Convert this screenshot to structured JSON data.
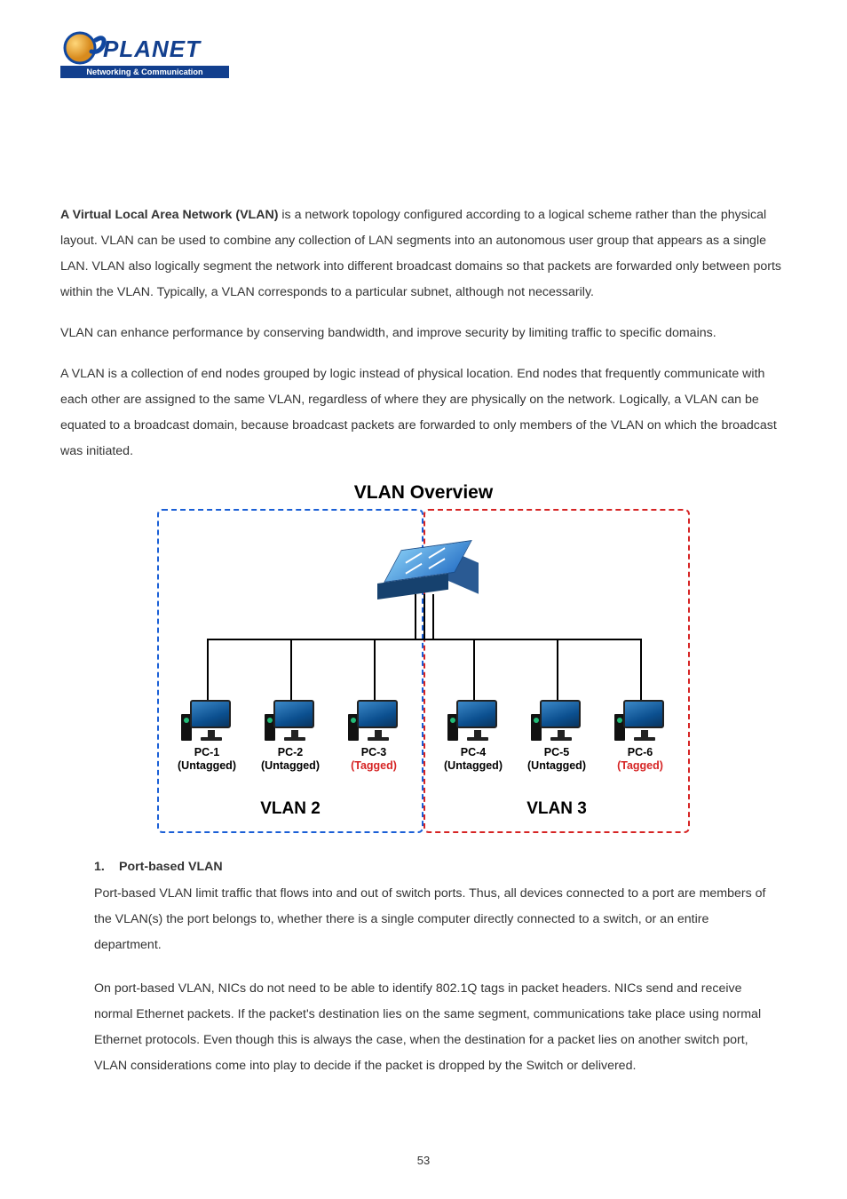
{
  "logo": {
    "brand_top": "PLANET",
    "brand_sub": "Networking & Communication"
  },
  "intro": {
    "bold": "A Virtual Local Area Network (VLAN)",
    "rest": " is a network topology configured according to a logical scheme rather than the physical layout. VLAN can be used to combine any collection of LAN segments into an autonomous user group that appears as a single LAN. VLAN also logically segment the network into different broadcast domains so that packets are forwarded only between ports within the VLAN. Typically, a VLAN corresponds to a particular subnet, although not necessarily."
  },
  "para2": "VLAN can enhance performance by conserving bandwidth, and improve security by limiting traffic to specific domains.",
  "para3": "A VLAN is a collection of end nodes grouped by logic instead of physical location. End nodes that frequently communicate with each other are assigned to the same VLAN, regardless of where they are physically on the network. Logically, a VLAN can be equated to a broadcast domain, because broadcast packets are forwarded to only members of the VLAN on which the broadcast was initiated.",
  "diagram": {
    "title": "VLAN Overview",
    "vlan_left_label": "VLAN 2",
    "vlan_right_label": "VLAN 3",
    "pcs": [
      {
        "name": "PC-1",
        "tag": "(Untagged)",
        "tag_style": "black"
      },
      {
        "name": "PC-2",
        "tag": "(Untagged)",
        "tag_style": "black"
      },
      {
        "name": "PC-3",
        "tag": "(Tagged)",
        "tag_style": "red"
      },
      {
        "name": "PC-4",
        "tag": "(Untagged)",
        "tag_style": "black"
      },
      {
        "name": "PC-5",
        "tag": "(Untagged)",
        "tag_style": "black"
      },
      {
        "name": "PC-6",
        "tag": "(Tagged)",
        "tag_style": "red"
      }
    ]
  },
  "port_based": {
    "heading": "Port-based VLAN",
    "p1": "Port-based VLAN limit traffic that flows into and out of switch ports. Thus, all devices connected to a port are members of the VLAN(s) the port belongs to, whether there is a single computer directly connected to a switch, or an entire department.",
    "p2": "On port-based VLAN, NICs do not need to be able to identify 802.1Q tags in packet headers. NICs send and receive normal Ethernet packets. If the packet's destination lies on the same segment, communications take place using normal Ethernet protocols. Even though this is always the case, when the destination for a packet lies on another switch port, VLAN considerations come into play to decide if the packet is dropped by the Switch or delivered."
  },
  "page_number": "53"
}
